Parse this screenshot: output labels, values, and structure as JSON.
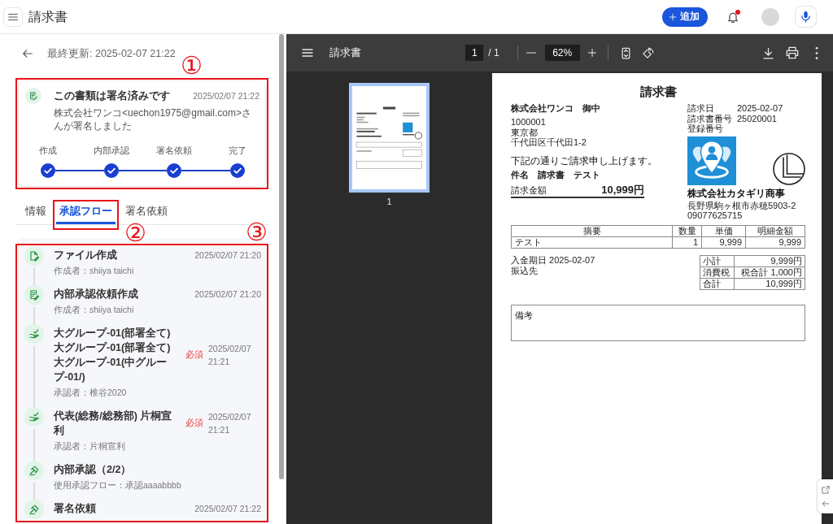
{
  "app_bar": {
    "title": "請求書",
    "add_button": "追加",
    "notification_badge": true
  },
  "detail_panel": {
    "last_updated": "最終更新: 2025-02-07 21:22",
    "status_card": {
      "highlighted": true,
      "annotation": "①",
      "title": "この書類は署名済みです",
      "time": "2025/02/07 21:22",
      "message": "株式会社ワンコ<uechon1975@gmail.com>さんが署名しました",
      "steps": [
        {
          "label": "作成",
          "done": true
        },
        {
          "label": "内部承認",
          "done": true
        },
        {
          "label": "署名依頼",
          "done": true
        },
        {
          "label": "完了",
          "done": true
        }
      ]
    },
    "tabs": [
      {
        "label": "情報",
        "selected": false,
        "highlighted": false
      },
      {
        "label": "承認フロー",
        "selected": true,
        "highlighted": true,
        "annotation": "②"
      },
      {
        "label": "署名依頼",
        "selected": false,
        "highlighted": false
      }
    ],
    "timeline": {
      "highlighted": true,
      "annotation": "③",
      "events": [
        {
          "kind": "file_created",
          "title": "ファイル作成",
          "time": "2025/02/07 21:20",
          "detail": "作成者：shiiya taichi"
        },
        {
          "kind": "request_created",
          "title": "内部承認依頼作成",
          "time": "2025/02/07 21:20",
          "detail": "作成者：shiiya taichi"
        },
        {
          "kind": "approver",
          "title": "大グループ-01(部署全て)大グループ-01(部署全て)大グループ-01(中グループ-01/)",
          "badge": "必須",
          "time": "2025/02/07 21:21",
          "detail": "承認者：椎谷2020"
        },
        {
          "kind": "approver",
          "title": "代表(総務/総務部) 片桐宣利",
          "badge": "必須",
          "time": "2025/02/07 21:21",
          "detail": "承認者：片桐宣利"
        },
        {
          "kind": "stage",
          "title": "内部承認（2/2）",
          "detail": "使用承認フロー：承認aaaabbbb"
        },
        {
          "kind": "signature_request",
          "title": "署名依頼",
          "time": "2025/02/07 21:22"
        }
      ]
    }
  },
  "pdf_viewer": {
    "title": "請求書",
    "page": "1",
    "page_total": "/ 1",
    "zoom": "62%",
    "thumbnails": [
      {
        "label": "1",
        "selected": true
      }
    ],
    "document": {
      "title": "請求書",
      "recipient": "株式会社ワンコ　御中",
      "recipient_address": [
        "1000001",
        "東京都",
        "千代田区千代田1-2"
      ],
      "greeting": "下記の通りご請求申し上げます。",
      "subject": "件名　請求書　テスト",
      "amount_label": "請求金額",
      "amount": "10,999円",
      "meta": [
        {
          "label": "請求日",
          "value": "2025-02-07"
        },
        {
          "label": "請求書番号",
          "value": "25020001"
        },
        {
          "label": "登録番号"
        }
      ],
      "issuer": "株式会社カタギリ商事",
      "issuer_address": [
        "長野県駒ヶ根市赤穂5903-2",
        "09077625715"
      ],
      "items": {
        "columns": [
          "摘要",
          "数量",
          "単価",
          "明細金額"
        ],
        "rows": [
          [
            "テスト",
            "1",
            "9,999",
            "9,999"
          ]
        ]
      },
      "due_date": "入金期日 2025-02-07",
      "bank": "振込先",
      "totals": [
        {
          "label": "小計",
          "value": "9,999円"
        },
        {
          "label": "消費税",
          "value": "税合計 1,000円"
        },
        {
          "label": "合計",
          "value": "10,999円"
        }
      ],
      "notes_label": "備考"
    }
  }
}
